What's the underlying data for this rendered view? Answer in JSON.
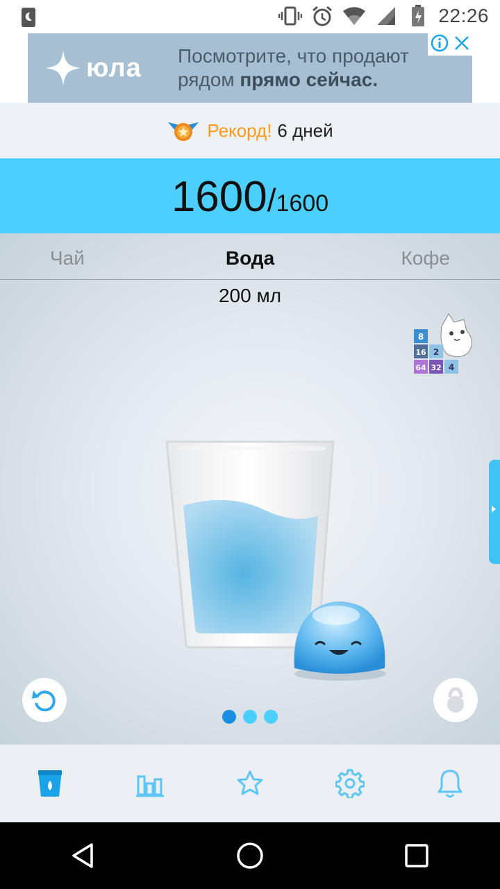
{
  "status_bar": {
    "time": "22:26",
    "icons": [
      "moon-icon",
      "vibrate-icon",
      "alarm-icon",
      "wifi-icon",
      "signal-icon",
      "battery-icon"
    ]
  },
  "ad": {
    "logo_text": "юла",
    "line1": "Посмотрите, что продают",
    "line2_plain": "рядом ",
    "line2_bold": "прямо сейчас.",
    "info_icon": "info-icon",
    "close_icon": "close-icon"
  },
  "record": {
    "accent": "Рекорд!",
    "days": "6 дней"
  },
  "goal": {
    "current": "1600",
    "separator": "/",
    "target": "1600"
  },
  "tabs": [
    {
      "label": "Чай"
    },
    {
      "label": "Вода",
      "active": true
    },
    {
      "label": "Кофе"
    }
  ],
  "amount": "200 мл",
  "promo_tiles": [
    "8",
    "16",
    "2",
    "64",
    "32",
    "4"
  ],
  "pager": {
    "count": 3,
    "active": 0
  },
  "bottom_nav": [
    {
      "icon": "glass-icon",
      "active": true
    },
    {
      "icon": "chart-icon"
    },
    {
      "icon": "star-icon"
    },
    {
      "icon": "gear-icon"
    },
    {
      "icon": "bell-icon"
    }
  ],
  "colors": {
    "accent": "#4ccffd",
    "accent_dark": "#1a8ee0",
    "record_accent": "#ff9a1f"
  }
}
